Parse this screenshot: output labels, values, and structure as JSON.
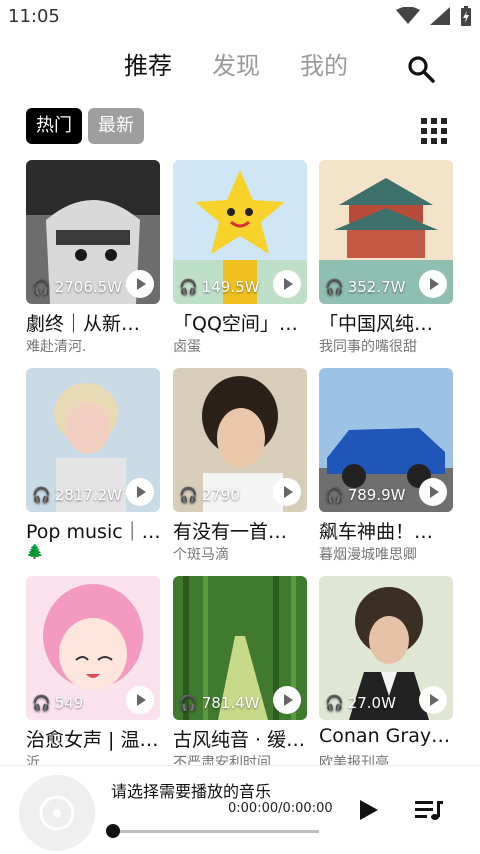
{
  "status_bar": {
    "time": "11:05"
  },
  "nav": {
    "tabs": [
      {
        "label": "推荐"
      },
      {
        "label": "发现"
      },
      {
        "label": "我的"
      }
    ]
  },
  "filters": {
    "chips": [
      {
        "label": "热门"
      },
      {
        "label": "最新"
      }
    ]
  },
  "playlists": [
    {
      "title": "劇终｜从新…",
      "subtitle": "难赴清河.",
      "play_count": "2706.5W"
    },
    {
      "title": "「QQ空间」…",
      "subtitle": "卤蛋",
      "play_count": "149.5W"
    },
    {
      "title": "「中国风纯…",
      "subtitle": "我同事的嘴很甜",
      "play_count": "352.7W"
    },
    {
      "title": "Pop music｜…",
      "subtitle": "🌲",
      "play_count": "2817.2W"
    },
    {
      "title": "有没有一首…",
      "subtitle": "个斑马滴",
      "play_count": "2790"
    },
    {
      "title": "飙车神曲！…",
      "subtitle": "暮烟漫城唯思卿",
      "play_count": "789.9W"
    },
    {
      "title": "治愈女声 | 温…",
      "subtitle": "沂",
      "play_count": "549"
    },
    {
      "title": "古风纯音 · 缓…",
      "subtitle": "不严肃安利时间",
      "play_count": "781.4W"
    },
    {
      "title": "Conan Gray…",
      "subtitle": "欧美报刊亭",
      "play_count": "27.0W"
    }
  ],
  "player": {
    "prompt": "请选择需要播放的音乐",
    "time": "0:00:00/0:00:00",
    "progress": 0
  },
  "colors": {
    "active_chip": "#000000",
    "inactive_chip": "#9e9e9e",
    "inactive_tab": "#9a9a9a"
  }
}
